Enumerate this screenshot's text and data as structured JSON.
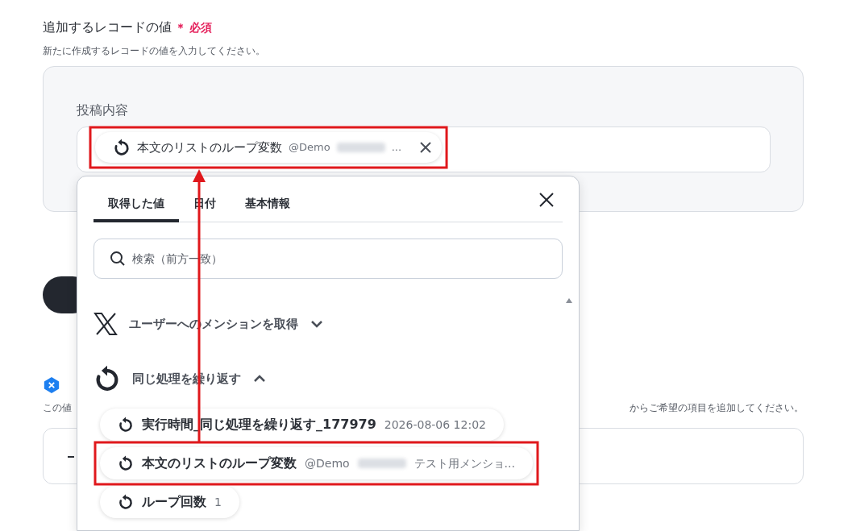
{
  "section": {
    "title": "追加するレコードの値",
    "required_mark": "＊",
    "required": "必須",
    "description": "新たに作成するレコードの値を入力してください。"
  },
  "field": {
    "label": "投稿内容",
    "chip": {
      "label": "本文のリストのループ変数",
      "sub": "@Demo",
      "suffix": "..."
    }
  },
  "section2": {
    "description_start": "この値",
    "description_end": "からご希望の項目を追加してください。"
  },
  "picker": {
    "tabs": [
      {
        "label": "取得した値",
        "selected": true
      },
      {
        "label": "日付",
        "selected": false
      },
      {
        "label": "基本情報",
        "selected": false
      }
    ],
    "search": {
      "placeholder": "検索（前方一致）"
    },
    "groups": [
      {
        "kind": "x",
        "title": "ユーザーへのメンションを取得",
        "expanded": false
      },
      {
        "kind": "loop",
        "title": "同じ処理を繰り返す",
        "expanded": true,
        "items": [
          {
            "label": "実行時間_同じ処理を繰り返す_177979",
            "value": "2026-08-06 12:02",
            "highlighted": false
          },
          {
            "label": "本文のリストのループ変数",
            "value": "@Demo",
            "suffix": "テスト用メンショ...",
            "blurred": true,
            "highlighted": true
          },
          {
            "label": "ループ回数",
            "value": "1",
            "highlighted": false
          }
        ]
      }
    ]
  }
}
